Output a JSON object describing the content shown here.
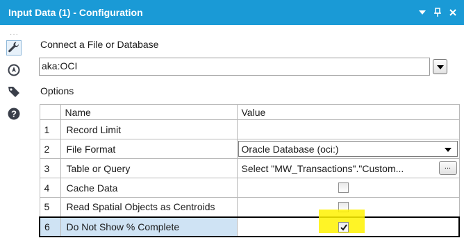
{
  "window": {
    "title": "Input Data (1) - Configuration"
  },
  "connect": {
    "label": "Connect a File or Database",
    "value": "aka:OCI"
  },
  "options": {
    "label": "Options",
    "columns": [
      "Name",
      "Value"
    ],
    "rows": [
      {
        "num": "1",
        "name": "Record Limit",
        "value": ""
      },
      {
        "num": "2",
        "name": "File Format",
        "value": "Oracle Database (oci:)"
      },
      {
        "num": "3",
        "name": "Table or Query",
        "value": "Select  \"MW_Transactions\".\"Custom..."
      },
      {
        "num": "4",
        "name": "Cache Data",
        "checked": false
      },
      {
        "num": "5",
        "name": "Read Spatial Objects as Centroids",
        "checked": false
      },
      {
        "num": "6",
        "name": "Do Not Show % Complete",
        "checked": true
      }
    ],
    "ellipsis_label": "..."
  },
  "icons": {
    "title_bar": [
      "dropdown-arrow-icon",
      "pin-icon",
      "close-icon"
    ],
    "left_bar": [
      "wrench-icon",
      "navigate-icon",
      "tag-icon",
      "help-icon"
    ]
  },
  "colors": {
    "title_bar": "#1a9ad6",
    "selected_row": "#cfe3f4",
    "check_highlight": "#fff200"
  }
}
